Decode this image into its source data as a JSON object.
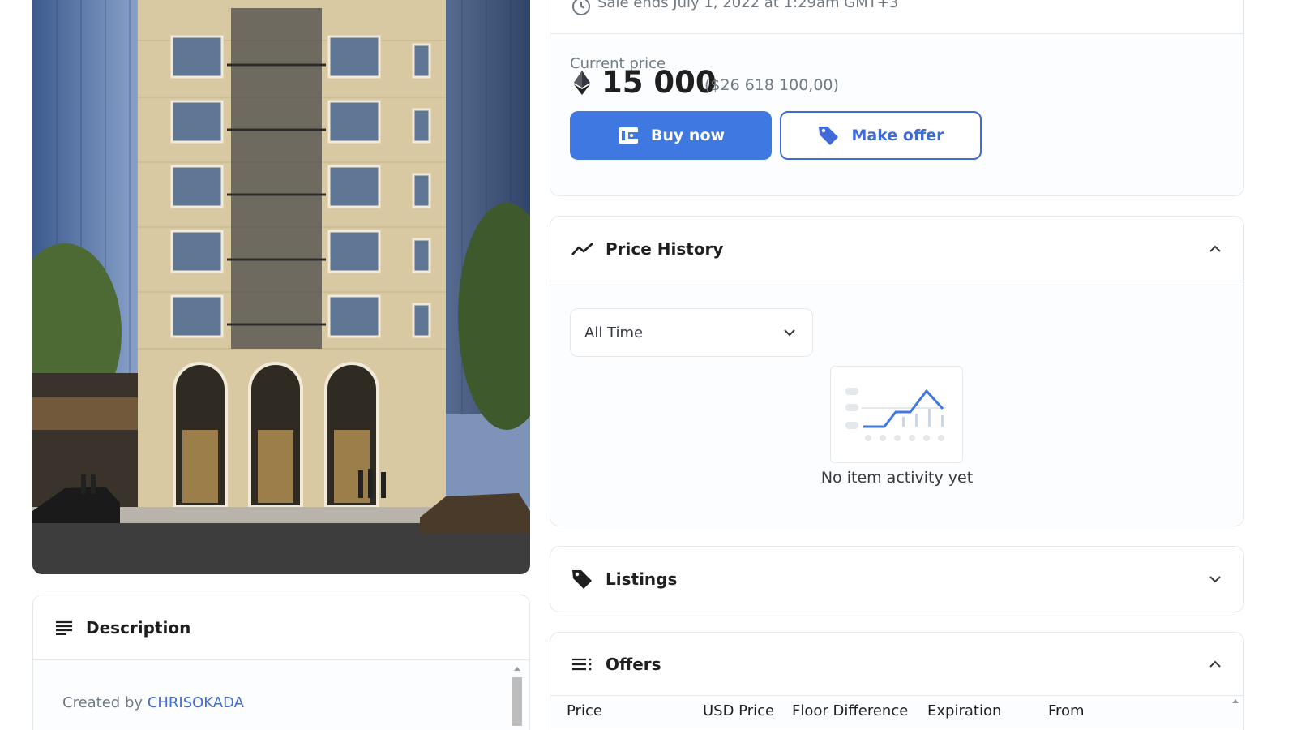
{
  "asset": {
    "image_alt": "Rendering of a historic beige stone apartment building with fire escapes, arched glass ground-floor windows, flanked by glass towers, cars parked on the street"
  },
  "description": {
    "title": "Description",
    "created_prefix": "Created by",
    "creator": "CHRISOKADA"
  },
  "sale": {
    "ends_text": "Sale ends July 1, 2022 at 1:29am GMT+3"
  },
  "price": {
    "label": "Current price",
    "amount": "15 000",
    "usd": "($26 618 100,00)",
    "currency_icon": "ethereum-icon"
  },
  "buttons": {
    "buy_now": "Buy now",
    "make_offer": "Make offer"
  },
  "price_history": {
    "title": "Price History",
    "filter_value": "All Time",
    "empty_text": "No item activity yet",
    "expanded": true
  },
  "listings": {
    "title": "Listings",
    "expanded": false
  },
  "offers": {
    "title": "Offers",
    "expanded": true,
    "columns": [
      "Price",
      "USD Price",
      "Floor Difference",
      "Expiration",
      "From"
    ]
  },
  "colors": {
    "accent": "#3f78e0",
    "link": "#3f6ad8",
    "muted_text": "#707a83",
    "border": "#e5e8eb"
  }
}
